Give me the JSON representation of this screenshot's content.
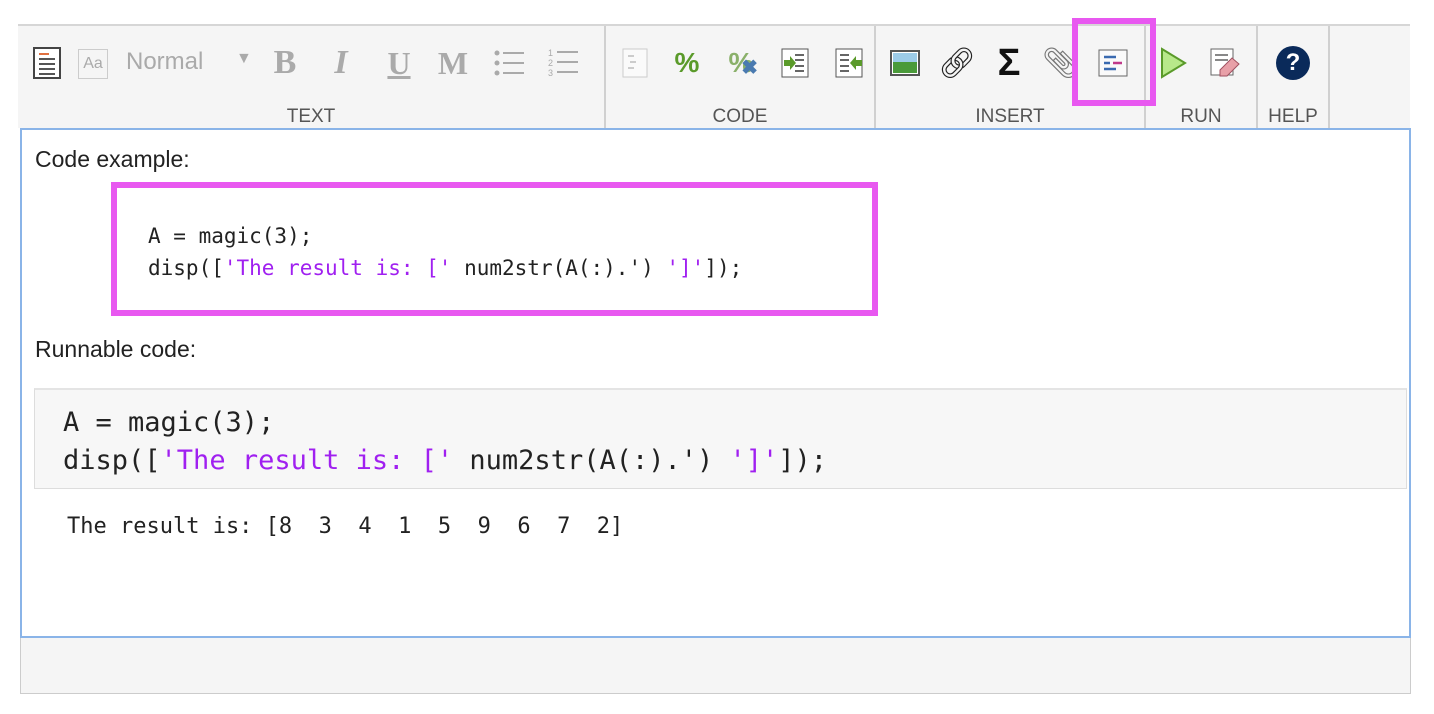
{
  "toolbar": {
    "style_select": "Normal",
    "sections": {
      "text": "TEXT",
      "code": "CODE",
      "insert": "INSERT",
      "run": "RUN",
      "help": "HELP"
    },
    "glyphs": {
      "bold": "B",
      "italic": "I",
      "underline": "U",
      "mono": "M",
      "percent": "%",
      "sigma": "Σ",
      "help": "?",
      "aa": "Aa"
    }
  },
  "editor": {
    "heading1": "Code example:",
    "heading2": "Runnable code:",
    "code": [
      [
        {
          "t": "A = magic(3);",
          "s": false
        }
      ],
      [
        {
          "t": "disp([",
          "s": false
        },
        {
          "t": "'The result is: ['",
          "s": true
        },
        {
          "t": " num2str(A(:).') ",
          "s": false
        },
        {
          "t": "']'",
          "s": true
        },
        {
          "t": "]);",
          "s": false
        }
      ]
    ],
    "output": "The result is: [8  3  4  1  5  9  6  7  2]"
  },
  "colors": {
    "highlight": "#e858f0",
    "string": "#a020f0",
    "focus_border": "#8ab4e8"
  }
}
